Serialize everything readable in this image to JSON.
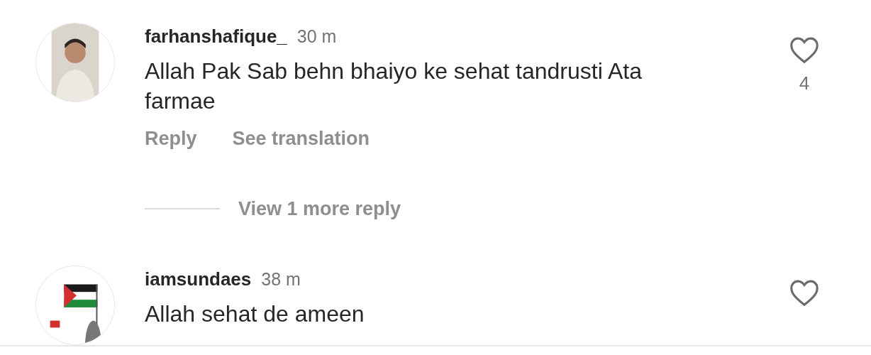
{
  "comments": [
    {
      "username": "farhanshafique_",
      "time": "30 m",
      "text": "Allah Pak Sab behn bhaiyo ke sehat tandrusti Ata farmae",
      "liked": false,
      "likes": "4",
      "actions": [
        "Reply",
        "See translation"
      ],
      "view_replies": "View 1 more reply"
    },
    {
      "username": "iamsundaes",
      "time": "38 m",
      "text": "Allah sehat de ameen",
      "liked": false
    }
  ]
}
